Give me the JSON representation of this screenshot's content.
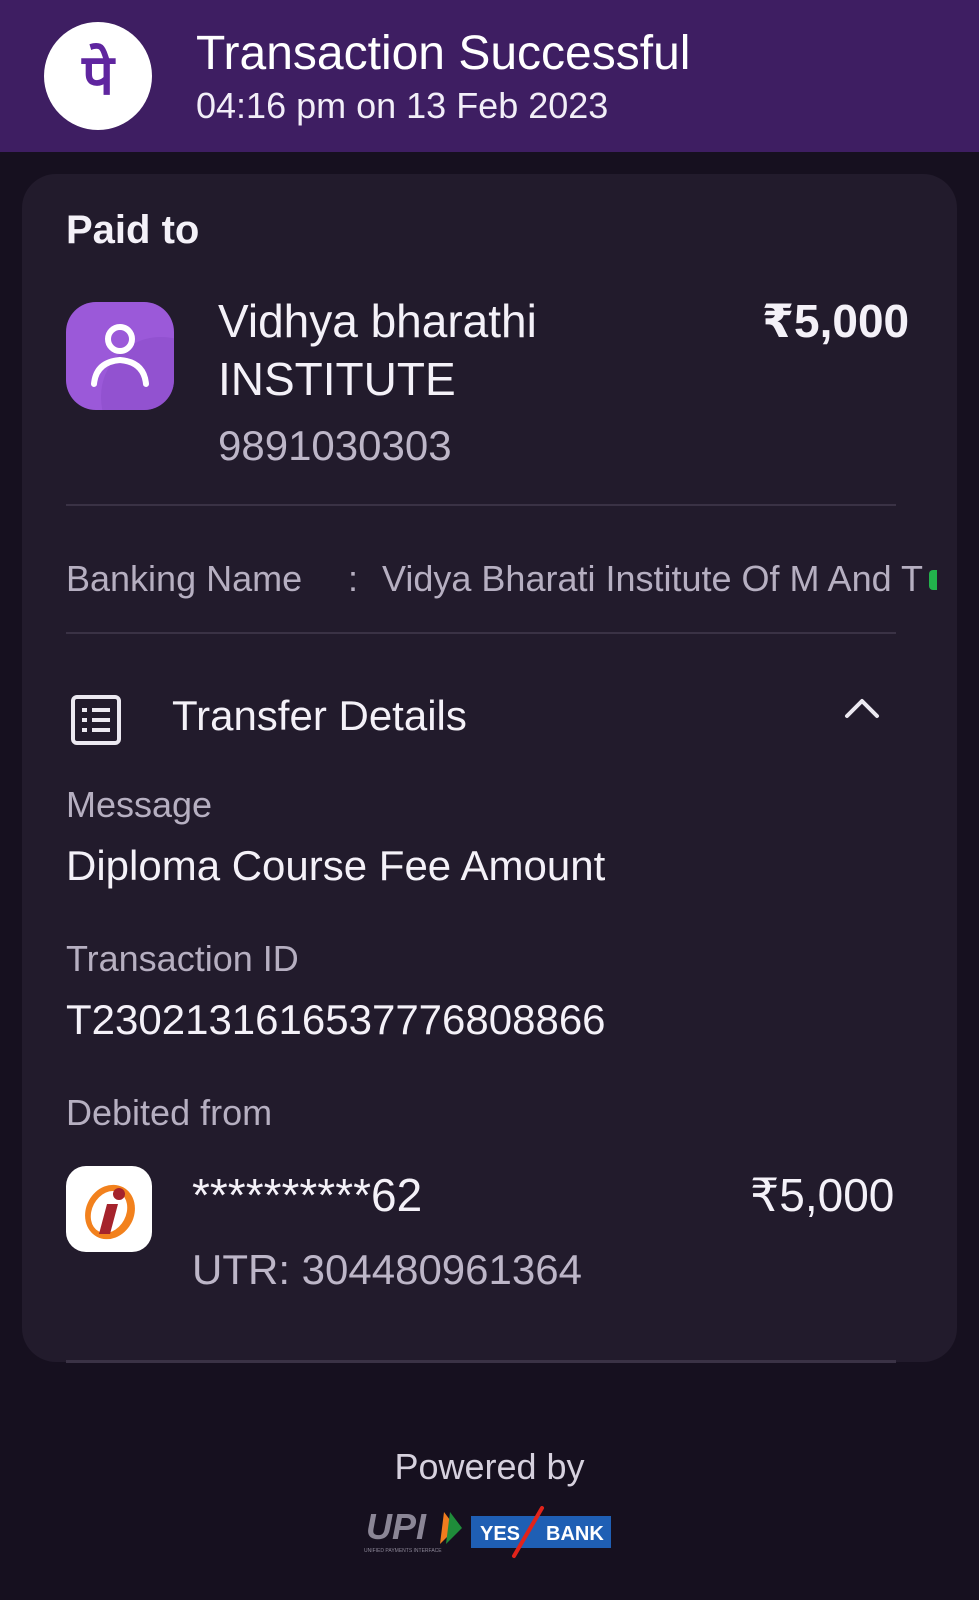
{
  "header": {
    "title": "Transaction Successful",
    "datetime": "04:16 pm on 13 Feb 2023",
    "logo_glyph": "पे",
    "background": "#3e1e62"
  },
  "payee": {
    "section_label": "Paid to",
    "name": "Vidhya bharathi INSTITUTE",
    "amount": "₹5,000",
    "phone": "9891030303",
    "icon": "person-icon"
  },
  "banking": {
    "label": "Banking Name",
    "separator": ":",
    "value": "Vidya Bharati Institute Of M And T"
  },
  "transfer_details": {
    "title": "Transfer Details",
    "icon": "document-list-icon",
    "toggle_icon": "chevron-up-icon",
    "message_label": "Message",
    "message_value": "Diploma Course Fee Amount",
    "transaction_id_label": "Transaction ID",
    "transaction_id_value": "T2302131616537776808866",
    "debited_from_label": "Debited from",
    "account_masked": "**********62",
    "debit_amount": "₹5,000",
    "utr": "UTR: 304480961364",
    "bank_icon": "icici-bank-icon"
  },
  "footer": {
    "powered_by": "Powered by",
    "upi_text": "UPI",
    "upi_subtext": "UNIFIED PAYMENTS INTERFACE",
    "yes_text": "YES",
    "bank_text": "BANK"
  },
  "colors": {
    "accent": "#5f259f",
    "card": "#221b2c",
    "background": "#16101f",
    "verified": "#22b24c"
  }
}
